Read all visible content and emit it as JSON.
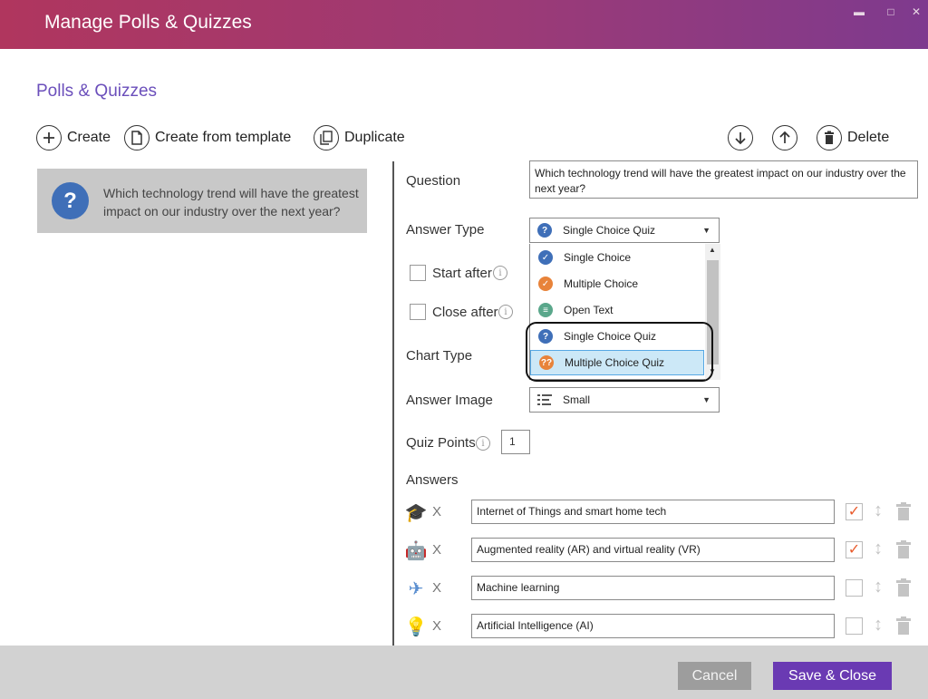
{
  "window": {
    "title": "Manage Polls & Quizzes",
    "minimize_glyph": "▬",
    "maximize_glyph": "□",
    "close_glyph": "✕"
  },
  "section_title": "Polls & Quizzes",
  "toolbar": {
    "create": "Create",
    "create_from_template": "Create from template",
    "duplicate": "Duplicate",
    "delete": "Delete"
  },
  "questions": [
    {
      "icon": "question-icon",
      "text": "Which technology trend will have the greatest impact on our industry over the next year?"
    }
  ],
  "form": {
    "question_label": "Question",
    "question_value": "Which technology trend will have the greatest impact on our industry over the next year?",
    "answer_type_label": "Answer Type",
    "answer_type_value": "Single Choice Quiz",
    "start_after_label": "Start after",
    "close_after_label": "Close after",
    "chart_type_label": "Chart Type",
    "answer_image_label": "Answer Image",
    "answer_image_value": "Small",
    "quiz_points_label": "Quiz Points",
    "quiz_points_value": "1",
    "answers_label": "Answers"
  },
  "answer_type_options": [
    {
      "label": "Single Choice",
      "icon": "check-circle-icon",
      "color": "#3f6fb8"
    },
    {
      "label": "Multiple Choice",
      "icon": "double-check-icon",
      "color": "#e8833a"
    },
    {
      "label": "Open Text",
      "icon": "chat-bubble-icon",
      "color": "#5aa78b"
    },
    {
      "label": "Single Choice Quiz",
      "icon": "question-circle-icon",
      "color": "#3f6fb8"
    },
    {
      "label": "Multiple Choice Quiz",
      "icon": "double-question-icon",
      "color": "#e8833a"
    }
  ],
  "answers": [
    {
      "icon": "graduation-cap-icon",
      "glyph": "🎓",
      "text": "Internet of Things and smart home tech",
      "correct": true,
      "remove": "X"
    },
    {
      "icon": "robot-icon",
      "glyph": "🤖",
      "text": "Augmented reality (AR) and virtual reality (VR)",
      "correct": true,
      "remove": "X"
    },
    {
      "icon": "airplane-icon",
      "glyph": "✈",
      "text": "Machine learning",
      "correct": false,
      "remove": "X"
    },
    {
      "icon": "light-bulb-icon",
      "glyph": "💡",
      "text": "Artificial Intelligence (AI)",
      "correct": false,
      "remove": "X"
    }
  ],
  "footer": {
    "cancel": "Cancel",
    "save_close": "Save & Close"
  },
  "colors": {
    "title_gradient_start": "#b0365e",
    "title_gradient_end": "#7e3a8e",
    "accent": "#6a3ab3",
    "check": "#e95b2c"
  }
}
